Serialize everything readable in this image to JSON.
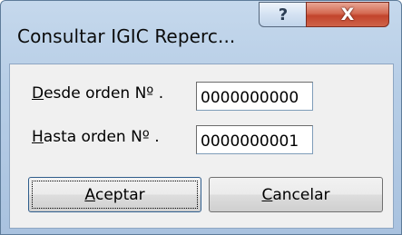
{
  "window": {
    "title": "Consultar  IGIC Reperc...",
    "help_glyph": "?",
    "close_glyph": "X"
  },
  "form": {
    "desde": {
      "label_mnemonic": "D",
      "label_rest": "esde orden Nº .",
      "value": "0000000000"
    },
    "hasta": {
      "label_mnemonic": "H",
      "label_rest": "asta orden Nº  .",
      "value": "0000000001"
    }
  },
  "buttons": {
    "accept": {
      "mnemonic": "A",
      "rest": "ceptar"
    },
    "cancel": {
      "mnemonic": "C",
      "rest": "ancelar"
    }
  },
  "colors": {
    "title_bar": "#b6cde6",
    "client_area": "#f0f0f0",
    "close_button": "#c2442c"
  }
}
